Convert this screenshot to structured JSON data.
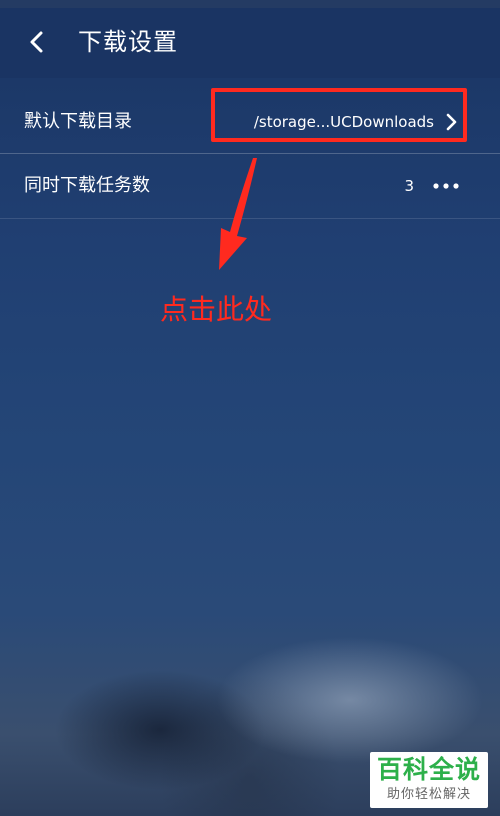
{
  "header": {
    "title": "下载设置",
    "back_icon": "chevron-left-icon"
  },
  "settings": [
    {
      "label": "默认下载目录",
      "value": "/storage...UCDownloads",
      "icon": "chevron-right-icon"
    },
    {
      "label": "同时下载任务数",
      "value": "3",
      "icon": "more-horizontal-icon"
    }
  ],
  "annotation": {
    "text": "点击此处",
    "color": "#ff2a1f"
  },
  "watermark": {
    "title": "百科全说",
    "subtitle": "助你轻松解决",
    "color": "#2db04a"
  }
}
